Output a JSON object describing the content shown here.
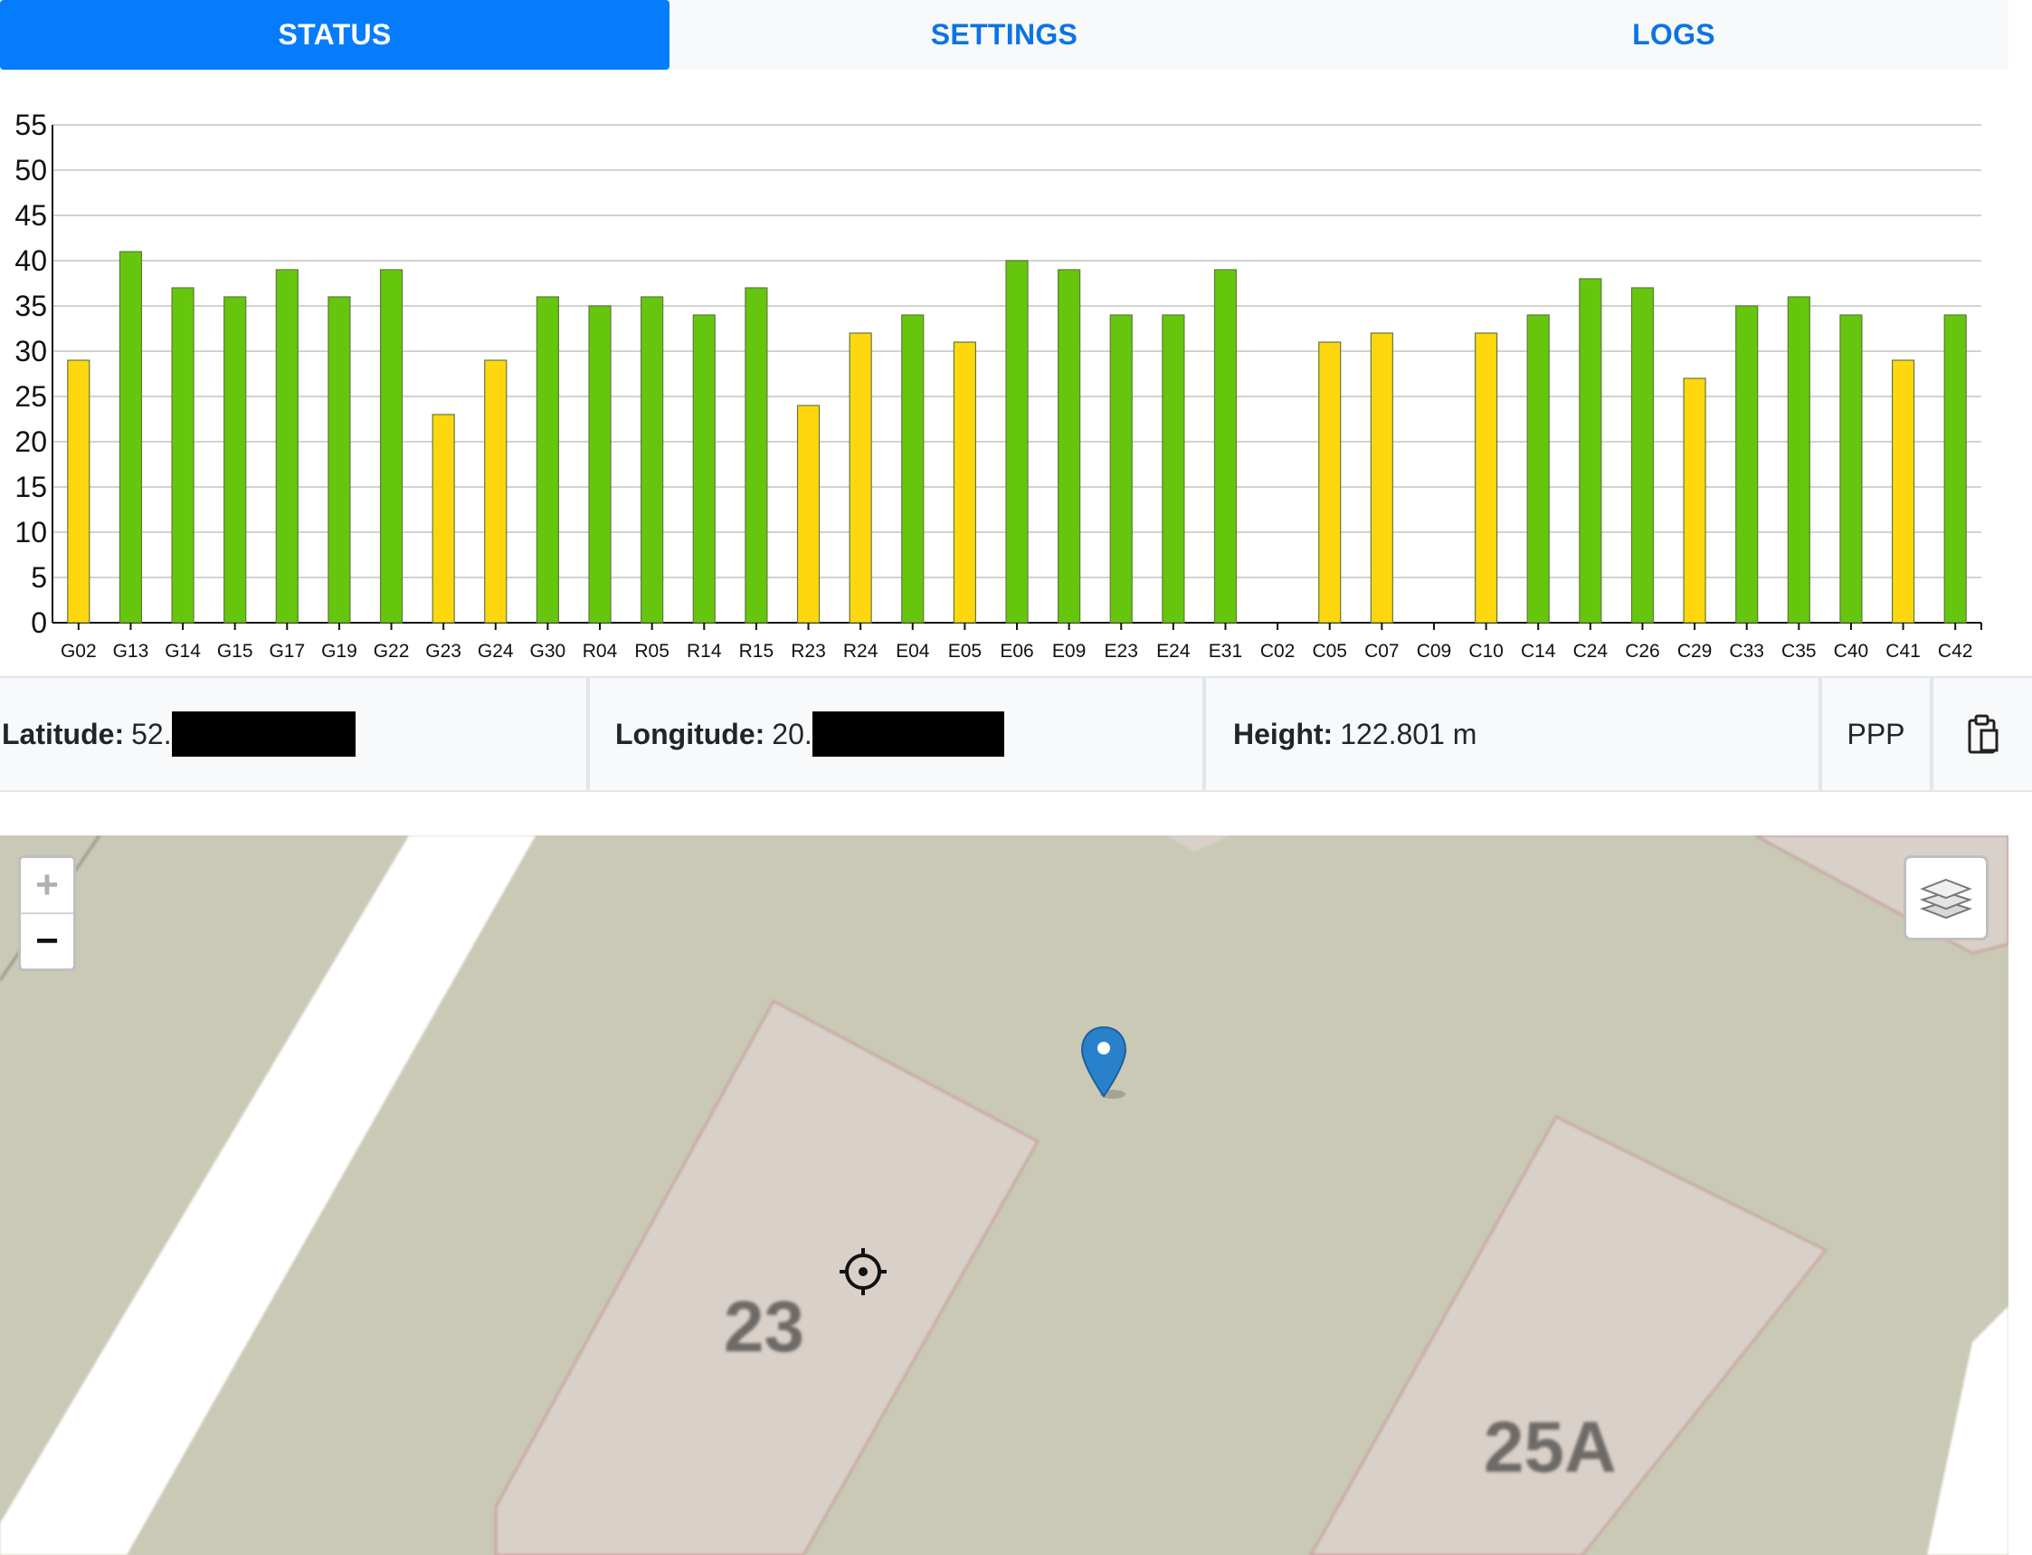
{
  "tabs": [
    {
      "label": "STATUS",
      "active": true
    },
    {
      "label": "SETTINGS",
      "active": false
    },
    {
      "label": "LOGS",
      "active": false
    }
  ],
  "chart_data": {
    "type": "bar",
    "title": "",
    "xlabel": "",
    "ylabel": "",
    "ylim": [
      0,
      55
    ],
    "yticks": [
      0,
      5,
      10,
      15,
      20,
      25,
      30,
      35,
      40,
      45,
      50,
      55
    ],
    "grid": true,
    "categories": [
      "G02",
      "G13",
      "G14",
      "G15",
      "G17",
      "G19",
      "G22",
      "G23",
      "G24",
      "G30",
      "R04",
      "R05",
      "R14",
      "R15",
      "R23",
      "R24",
      "E04",
      "E05",
      "E06",
      "E09",
      "E23",
      "E24",
      "E31",
      "C02",
      "C05",
      "C07",
      "C09",
      "C10",
      "C14",
      "C24",
      "C26",
      "C29",
      "C33",
      "C35",
      "C40",
      "C41",
      "C42"
    ],
    "values": [
      29,
      41,
      37,
      36,
      39,
      36,
      39,
      23,
      29,
      36,
      35,
      36,
      34,
      37,
      24,
      32,
      34,
      31,
      40,
      39,
      34,
      34,
      39,
      0,
      31,
      32,
      0,
      32,
      34,
      38,
      37,
      27,
      35,
      36,
      34,
      29,
      34
    ],
    "bar_colors": [
      "#ffd70f",
      "#66c60d",
      "#66c60d",
      "#66c60d",
      "#66c60d",
      "#66c60d",
      "#66c60d",
      "#ffd70f",
      "#ffd70f",
      "#66c60d",
      "#66c60d",
      "#66c60d",
      "#66c60d",
      "#66c60d",
      "#ffd70f",
      "#ffd70f",
      "#66c60d",
      "#ffd70f",
      "#66c60d",
      "#66c60d",
      "#66c60d",
      "#66c60d",
      "#66c60d",
      "#66c60d",
      "#ffd70f",
      "#ffd70f",
      "#66c60d",
      "#ffd70f",
      "#66c60d",
      "#66c60d",
      "#66c60d",
      "#ffd70f",
      "#66c60d",
      "#66c60d",
      "#66c60d",
      "#ffd70f",
      "#66c60d"
    ]
  },
  "info": {
    "latitude_label": "Latitude:",
    "latitude_value": "52.",
    "longitude_label": "Longitude:",
    "longitude_value": "20.",
    "height_label": "Height:",
    "height_value": "122.801 m",
    "solution": "PPP"
  },
  "map": {
    "zoom_in": "+",
    "zoom_out": "−",
    "house_numbers": [
      "23",
      "25A"
    ]
  },
  "colors": {
    "accent": "#057cfc",
    "bar_good": "#66c60d",
    "bar_fair": "#ffd70f",
    "map_ground": "#c9c9b6",
    "map_building": "#d9d0c9",
    "marker": "#2a81cb"
  }
}
